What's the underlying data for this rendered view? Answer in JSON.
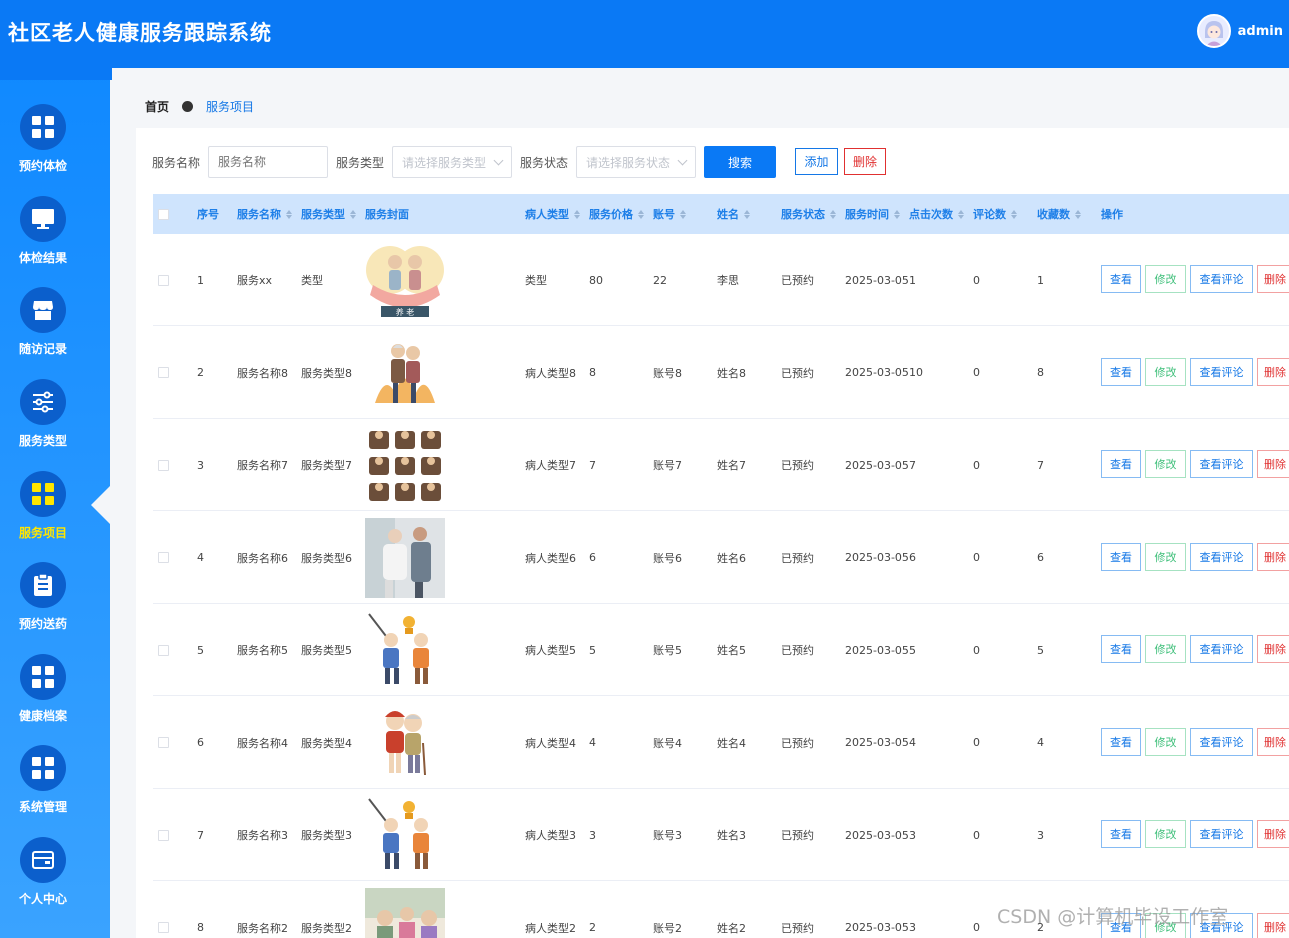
{
  "header": {
    "title": "社区老人健康服务跟踪系统",
    "username": "admin"
  },
  "sidebar": {
    "items": [
      {
        "label": "预约体检",
        "icon": "grid-icon"
      },
      {
        "label": "体检结果",
        "icon": "monitor-icon"
      },
      {
        "label": "随访记录",
        "icon": "store-icon"
      },
      {
        "label": "服务类型",
        "icon": "sliders-icon"
      },
      {
        "label": "服务项目",
        "icon": "grid-icon",
        "active": true
      },
      {
        "label": "预约送药",
        "icon": "clipboard-icon"
      },
      {
        "label": "健康档案",
        "icon": "grid-icon"
      },
      {
        "label": "系统管理",
        "icon": "grid-icon"
      },
      {
        "label": "个人中心",
        "icon": "wallet-icon"
      }
    ]
  },
  "breadcrumb": {
    "home": "首页",
    "current": "服务项目"
  },
  "search": {
    "name_label": "服务名称",
    "name_placeholder": "服务名称",
    "type_label": "服务类型",
    "type_placeholder": "请选择服务类型",
    "status_label": "服务状态",
    "status_placeholder": "请选择服务状态",
    "search_button": "搜索",
    "add_button": "添加",
    "delete_button": "删除"
  },
  "table": {
    "columns": [
      "序号",
      "服务名称",
      "服务类型",
      "服务封面",
      "病人类型",
      "服务价格",
      "账号",
      "姓名",
      "服务状态",
      "服务时间",
      "点击次数",
      "评论数",
      "收藏数",
      "操作"
    ],
    "actions": {
      "view": "查看",
      "edit": "修改",
      "comments": "查看评论",
      "delete": "删除"
    },
    "rows": [
      {
        "no": "1",
        "name": "服务xx",
        "type": "类型",
        "patient_type": "类型",
        "price": "80",
        "account": "22",
        "person": "李思",
        "status": "已预约",
        "time": "2025-03-05",
        "clicks": "1",
        "comments": "0",
        "favorites": "1",
        "thumb_caption": "养 老"
      },
      {
        "no": "2",
        "name": "服务名称8",
        "type": "服务类型8",
        "patient_type": "病人类型8",
        "price": "8",
        "account": "账号8",
        "person": "姓名8",
        "status": "已预约",
        "time": "2025-03-05",
        "clicks": "10",
        "comments": "0",
        "favorites": "8"
      },
      {
        "no": "3",
        "name": "服务名称7",
        "type": "服务类型7",
        "patient_type": "病人类型7",
        "price": "7",
        "account": "账号7",
        "person": "姓名7",
        "status": "已预约",
        "time": "2025-03-05",
        "clicks": "7",
        "comments": "0",
        "favorites": "7"
      },
      {
        "no": "4",
        "name": "服务名称6",
        "type": "服务类型6",
        "patient_type": "病人类型6",
        "price": "6",
        "account": "账号6",
        "person": "姓名6",
        "status": "已预约",
        "time": "2025-03-05",
        "clicks": "6",
        "comments": "0",
        "favorites": "6"
      },
      {
        "no": "5",
        "name": "服务名称5",
        "type": "服务类型5",
        "patient_type": "病人类型5",
        "price": "5",
        "account": "账号5",
        "person": "姓名5",
        "status": "已预约",
        "time": "2025-03-05",
        "clicks": "5",
        "comments": "0",
        "favorites": "5"
      },
      {
        "no": "6",
        "name": "服务名称4",
        "type": "服务类型4",
        "patient_type": "病人类型4",
        "price": "4",
        "account": "账号4",
        "person": "姓名4",
        "status": "已预约",
        "time": "2025-03-05",
        "clicks": "4",
        "comments": "0",
        "favorites": "4"
      },
      {
        "no": "7",
        "name": "服务名称3",
        "type": "服务类型3",
        "patient_type": "病人类型3",
        "price": "3",
        "account": "账号3",
        "person": "姓名3",
        "status": "已预约",
        "time": "2025-03-05",
        "clicks": "3",
        "comments": "0",
        "favorites": "3"
      },
      {
        "no": "8",
        "name": "服务名称2",
        "type": "服务类型2",
        "patient_type": "病人类型2",
        "price": "2",
        "account": "账号2",
        "person": "姓名2",
        "status": "已预约",
        "time": "2025-03-05",
        "clicks": "3",
        "comments": "0",
        "favorites": "2"
      }
    ]
  },
  "watermark": "CSDN @计算机毕设工作室",
  "colors": {
    "primary": "#0a79f5",
    "active_nav": "#ffe600",
    "danger": "#e03030",
    "success": "#3fbf7a",
    "table_header_bg": "#cfe4fd"
  }
}
